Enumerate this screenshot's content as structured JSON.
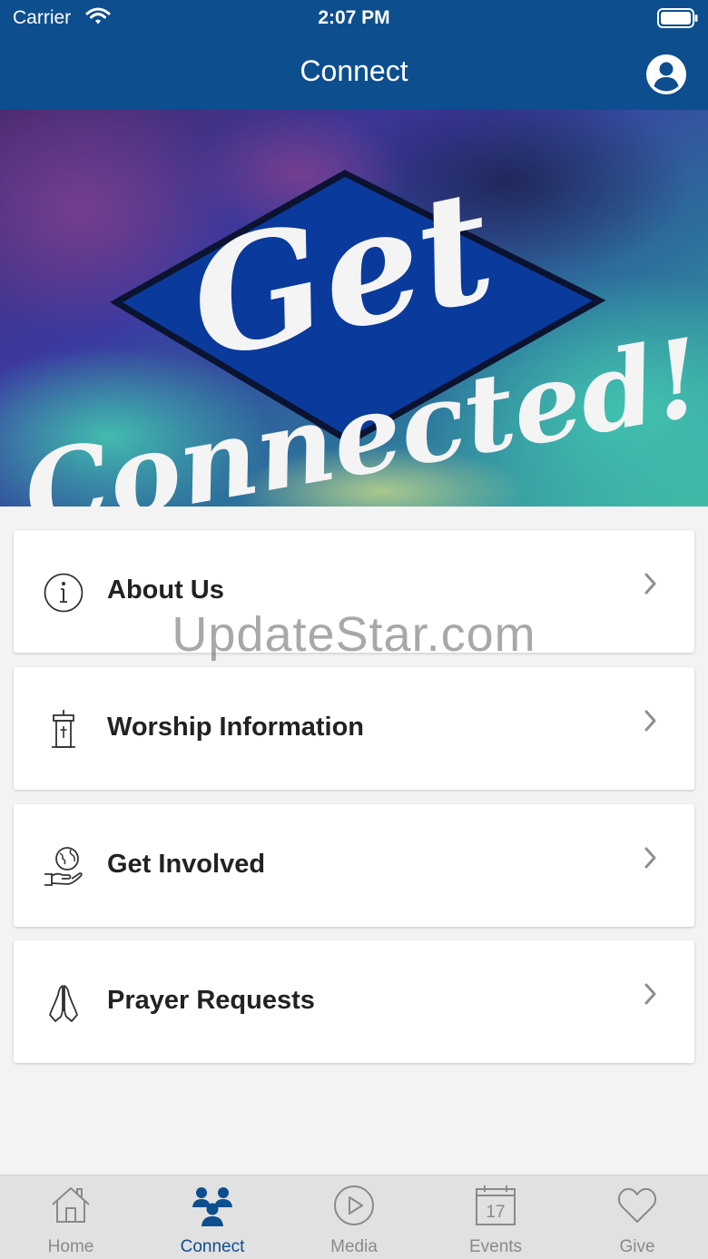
{
  "status_bar": {
    "carrier": "Carrier",
    "time": "2:07 PM"
  },
  "nav": {
    "title": "Connect",
    "profile_icon": "user-circle-icon"
  },
  "hero": {
    "text_line1": "Get",
    "text_line2": "Connected!"
  },
  "menu": [
    {
      "label": "About Us",
      "icon": "info-icon"
    },
    {
      "label": "Worship Information",
      "icon": "pulpit-icon"
    },
    {
      "label": "Get Involved",
      "icon": "globe-hand-icon"
    },
    {
      "label": "Prayer Requests",
      "icon": "praying-hands-icon"
    }
  ],
  "watermark": "UpdateStar.com",
  "tabs": [
    {
      "label": "Home",
      "icon": "home-icon",
      "active": false
    },
    {
      "label": "Connect",
      "icon": "people-icon",
      "active": true
    },
    {
      "label": "Media",
      "icon": "play-icon",
      "active": false
    },
    {
      "label": "Events",
      "icon": "calendar-icon",
      "calendar_day": "17",
      "active": false
    },
    {
      "label": "Give",
      "icon": "heart-icon",
      "active": false
    }
  ],
  "colors": {
    "brand": "#0d4e8f",
    "tab_inactive": "#8a8a8a",
    "tab_bar_bg": "#e1e1e1"
  }
}
